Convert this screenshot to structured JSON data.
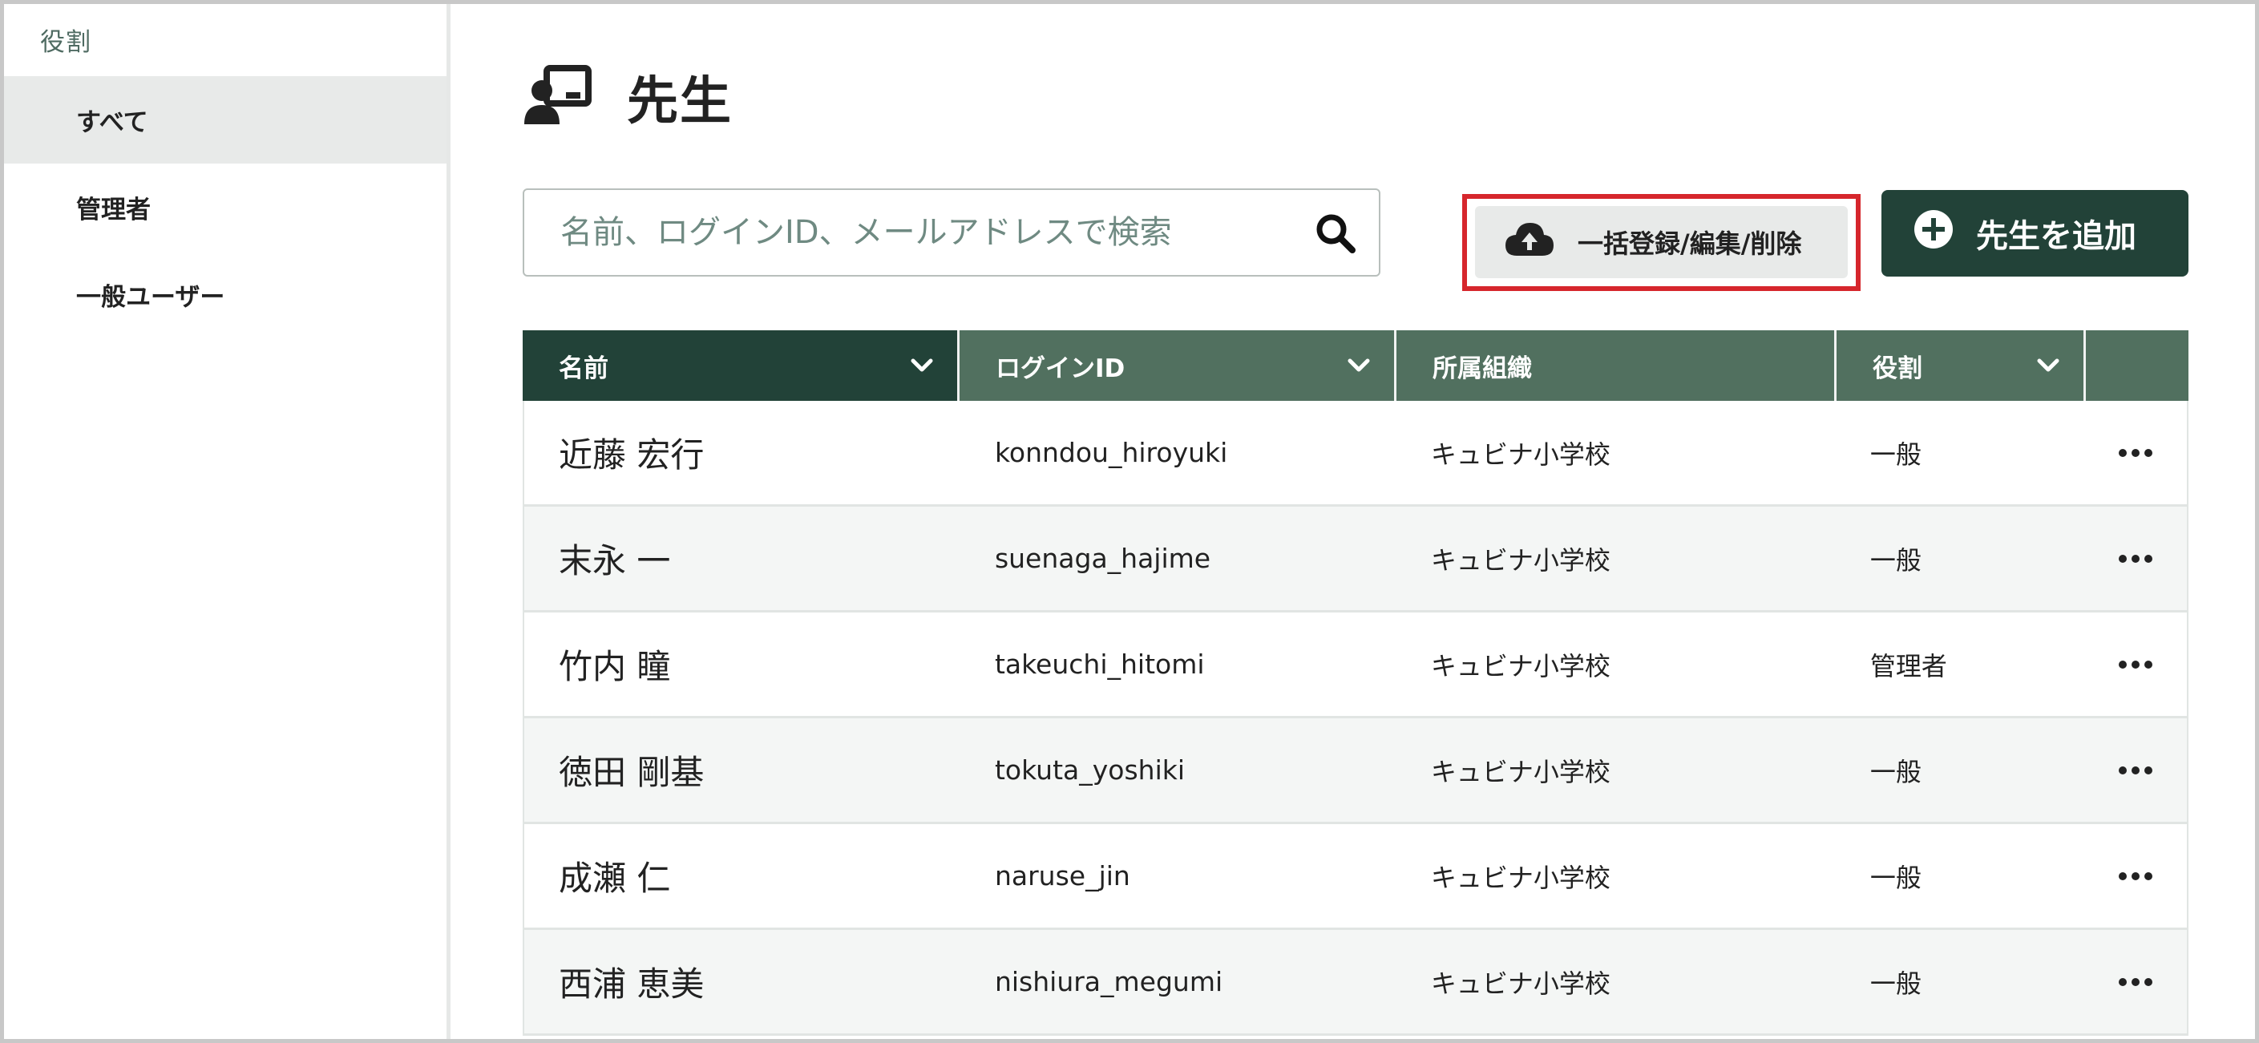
{
  "sidebar": {
    "section_label": "役割",
    "items": [
      {
        "label": "すべて",
        "active": true
      },
      {
        "label": "管理者",
        "active": false
      },
      {
        "label": "一般ユーザー",
        "active": false
      }
    ]
  },
  "header": {
    "title": "先生",
    "title_icon": "teacher-board-icon"
  },
  "search": {
    "placeholder": "名前、ログインID、メールアドレスで検索",
    "value": "",
    "icon": "search-icon"
  },
  "toolbar": {
    "bulk_label": "一括登録/編集/削除",
    "bulk_icon": "cloud-upload-icon",
    "add_label": "先生を追加",
    "add_icon": "plus-circle-icon"
  },
  "table": {
    "columns": [
      {
        "label": "名前",
        "sortable": true
      },
      {
        "label": "ログインID",
        "sortable": true
      },
      {
        "label": "所属組織",
        "sortable": false
      },
      {
        "label": "役割",
        "sortable": true
      },
      {
        "label": "",
        "sortable": false
      }
    ],
    "rows": [
      {
        "name": "近藤 宏行",
        "login_id": "konndou_hiroyuki",
        "org": "キュビナ小学校",
        "role": "一般"
      },
      {
        "name": "末永 一",
        "login_id": "suenaga_hajime",
        "org": "キュビナ小学校",
        "role": "一般"
      },
      {
        "name": "竹内 瞳",
        "login_id": "takeuchi_hitomi",
        "org": "キュビナ小学校",
        "role": "管理者"
      },
      {
        "name": "徳田 剛基",
        "login_id": "tokuta_yoshiki",
        "org": "キュビナ小学校",
        "role": "一般"
      },
      {
        "name": "成瀬 仁",
        "login_id": "naruse_jin",
        "org": "キュビナ小学校",
        "role": "一般"
      },
      {
        "name": "西浦 恵美",
        "login_id": "nishiura_megumi",
        "org": "キュビナ小学校",
        "role": "一般"
      }
    ]
  },
  "colors": {
    "header_dark": "#224238",
    "header_mid": "#51705f",
    "highlight": "#d6262c",
    "sidebar_active": "#e8eae9"
  }
}
